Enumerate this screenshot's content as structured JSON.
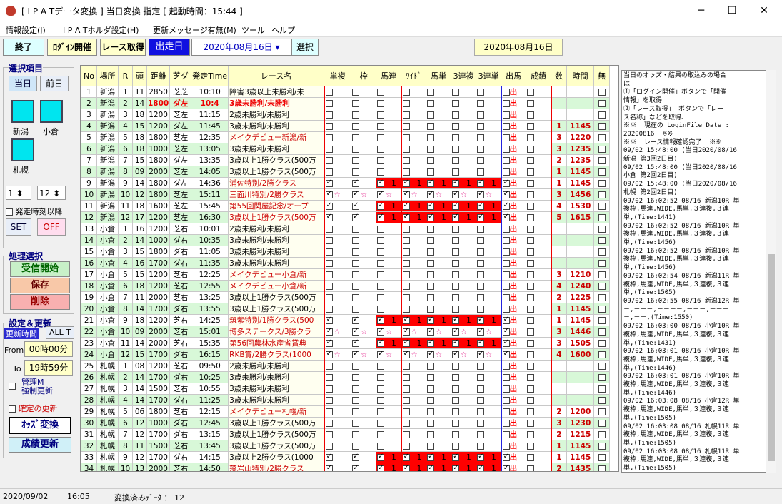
{
  "window": {
    "title": "[ I P A Tデータ変換 ]   当日変換 指定 [ 起動時間：15:44 ]"
  },
  "menu": [
    "情報設定(J)",
    "I P A Tホルダ設定(H)",
    "更新メッセージ有無(M)",
    "ツール",
    "ヘルプ"
  ],
  "toolbar": {
    "end": "終了",
    "login": "ﾛｸﾞｲﾝ開催",
    "race": "レース取得",
    "date_label": "出走日",
    "date_value": "2020年08月16日",
    "select": "選択",
    "date_display": "2020年08月16日"
  },
  "left": {
    "select_title": "選択項目",
    "today": "当日",
    "prev": "前日",
    "venues": [
      "新潟",
      "小倉",
      "札幌"
    ],
    "spin1": "1",
    "spin2": "12",
    "after_start": "発走時刻以降",
    "set": "SET",
    "off": "OFF",
    "proc_title": "処理選択",
    "recv": "受信開始",
    "save": "保存",
    "del": "削除",
    "setting_title": "設定＆更新",
    "update_time": "更新時間",
    "alt": "ALL T",
    "from_label": "From",
    "from_val": "00時00分",
    "to_label": "To",
    "to_val": "19時59分",
    "manage1": "管理M",
    "manage2": "強制更新",
    "confirm": "確定の更新",
    "odds": "ｵｯｽﾞ変換",
    "result": "成績更新"
  },
  "grid": {
    "headers": [
      "No",
      "場所",
      "R",
      "頭",
      "距離",
      "芝ダ",
      "発走Time",
      "レース名",
      "単複",
      "枠",
      "馬連",
      "ﾜｲﾄﾞ",
      "馬単",
      "3連複",
      "3連単",
      "出馬",
      "成績",
      "数",
      "時間",
      "無"
    ],
    "rows": [
      [
        "1",
        "新潟",
        "1",
        "11",
        "2850",
        "芝芝",
        "10:10",
        "障害3歳以上未勝利/未"
      ],
      [
        "2",
        "新潟",
        "2",
        "14",
        "1800",
        "ダ左",
        "10:4",
        "3歳未勝利/未勝利"
      ],
      [
        "3",
        "新潟",
        "3",
        "18",
        "1200",
        "芝左",
        "11:15",
        "2歳未勝利/未勝利"
      ],
      [
        "4",
        "新潟",
        "4",
        "15",
        "1200",
        "ダ左",
        "11:45",
        "3歳未勝利/未勝利"
      ],
      [
        "5",
        "新潟",
        "5",
        "18",
        "1800",
        "芝左",
        "12:35",
        "メイクデビュー新潟/新"
      ],
      [
        "6",
        "新潟",
        "6",
        "18",
        "1000",
        "芝左",
        "13:05",
        "3歳未勝利/未勝利"
      ],
      [
        "7",
        "新潟",
        "7",
        "15",
        "1800",
        "ダ左",
        "13:35",
        "3歳以上1勝クラス(500万"
      ],
      [
        "8",
        "新潟",
        "8",
        "09",
        "2000",
        "芝左",
        "14:05",
        "3歳以上1勝クラス(500万"
      ],
      [
        "9",
        "新潟",
        "9",
        "14",
        "1800",
        "ダ左",
        "14:36",
        "浦佐特別/2勝クラス"
      ],
      [
        "10",
        "新潟",
        "10",
        "12",
        "1800",
        "芝左",
        "15:11",
        "三面川特別/2勝クラス"
      ],
      [
        "11",
        "新潟",
        "11",
        "18",
        "1600",
        "芝左",
        "15:45",
        "第55回関屋記念/オープ"
      ],
      [
        "12",
        "新潟",
        "12",
        "17",
        "1200",
        "芝左",
        "16:30",
        "3歳以上1勝クラス(500万"
      ],
      [
        "13",
        "小倉",
        "1",
        "16",
        "1200",
        "芝右",
        "10:01",
        "2歳未勝利/未勝利"
      ],
      [
        "14",
        "小倉",
        "2",
        "14",
        "1000",
        "ダ右",
        "10:35",
        "3歳未勝利/未勝利"
      ],
      [
        "15",
        "小倉",
        "3",
        "15",
        "1800",
        "ダ右",
        "11:05",
        "3歳未勝利/未勝利"
      ],
      [
        "16",
        "小倉",
        "4",
        "16",
        "1700",
        "ダ右",
        "11:35",
        "3歳未勝利/未勝利"
      ],
      [
        "17",
        "小倉",
        "5",
        "15",
        "1200",
        "芝右",
        "12:25",
        "メイクデビュー小倉/新"
      ],
      [
        "18",
        "小倉",
        "6",
        "18",
        "1200",
        "芝右",
        "12:55",
        "メイクデビュー小倉/新"
      ],
      [
        "19",
        "小倉",
        "7",
        "11",
        "2000",
        "芝右",
        "13:25",
        "3歳以上1勝クラス(500万"
      ],
      [
        "20",
        "小倉",
        "8",
        "14",
        "1700",
        "ダ右",
        "13:55",
        "3歳以上1勝クラス(500万"
      ],
      [
        "21",
        "小倉",
        "9",
        "18",
        "1200",
        "芝右",
        "14:25",
        "筑紫特別/1勝クラス(500"
      ],
      [
        "22",
        "小倉",
        "10",
        "09",
        "2000",
        "芝右",
        "15:01",
        "博多ステークス/3勝クラ"
      ],
      [
        "23",
        "小倉",
        "11",
        "14",
        "2000",
        "芝右",
        "15:35",
        "第56回農林水産省賞典"
      ],
      [
        "24",
        "小倉",
        "12",
        "15",
        "1700",
        "ダ右",
        "16:15",
        "RKB賞/2勝クラス(1000"
      ],
      [
        "25",
        "札幌",
        "1",
        "08",
        "1200",
        "芝右",
        "09:50",
        "2歳未勝利/未勝利"
      ],
      [
        "26",
        "札幌",
        "2",
        "14",
        "1700",
        "ダ右",
        "10:25",
        "3歳未勝利/未勝利"
      ],
      [
        "27",
        "札幌",
        "3",
        "14",
        "1500",
        "芝右",
        "10:55",
        "3歳未勝利/未勝利"
      ],
      [
        "28",
        "札幌",
        "4",
        "14",
        "1700",
        "ダ右",
        "11:25",
        "3歳未勝利/未勝利"
      ],
      [
        "29",
        "札幌",
        "5",
        "06",
        "1800",
        "芝右",
        "12:15",
        "メイクデビュー札幌/新"
      ],
      [
        "30",
        "札幌",
        "6",
        "12",
        "1000",
        "ダ右",
        "12:45",
        "3歳以上1勝クラス(500万"
      ],
      [
        "31",
        "札幌",
        "7",
        "12",
        "1700",
        "ダ右",
        "13:15",
        "3歳以上1勝クラス(500万"
      ],
      [
        "32",
        "札幌",
        "8",
        "11",
        "1500",
        "芝右",
        "13:45",
        "3歳以上1勝クラス(500万"
      ],
      [
        "33",
        "札幌",
        "9",
        "12",
        "1700",
        "ダ右",
        "14:15",
        "3歳以上2勝クラス(1000"
      ],
      [
        "34",
        "札幌",
        "10",
        "13",
        "2000",
        "芝右",
        "14:50",
        "藻岩山特別/2勝クラス"
      ],
      [
        "35",
        "札幌",
        "11",
        "13",
        "2000",
        "芝右",
        "15:25",
        "UHB賞/オープン"
      ],
      [
        "36",
        "札幌",
        "12",
        "10",
        "1800",
        "芝右",
        "16:05",
        "石狩特別/1勝クラス(500"
      ]
    ],
    "counts": {
      "4": [
        "1",
        "1145"
      ],
      "5": [
        "3",
        "1220"
      ],
      "6": [
        "3",
        "1235"
      ],
      "7": [
        "2",
        "1235"
      ],
      "8": [
        "1",
        "1145"
      ],
      "9": [
        "1",
        "1145"
      ],
      "10": [
        "3",
        "1456"
      ],
      "11": [
        "4",
        "1530"
      ],
      "12": [
        "5",
        "1615"
      ],
      "17": [
        "3",
        "1210"
      ],
      "18": [
        "4",
        "1240"
      ],
      "19": [
        "2",
        "1225"
      ],
      "20": [
        "1",
        "1145"
      ],
      "21": [
        "1",
        "1145"
      ],
      "22": [
        "3",
        "1446"
      ],
      "23": [
        "3",
        "1505"
      ],
      "24": [
        "4",
        "1600"
      ],
      "29": [
        "2",
        "1200"
      ],
      "30": [
        "3",
        "1230"
      ],
      "31": [
        "2",
        "1215"
      ],
      "32": [
        "1",
        "1145"
      ],
      "33": [
        "1",
        "1145"
      ],
      "34": [
        "2",
        "1435"
      ],
      "35": [
        "4",
        "1505"
      ],
      "36": [
        "4",
        "1550"
      ]
    },
    "shutsu": "出",
    "one": "1",
    "star": "☆",
    "tf": "TF"
  },
  "log": [
    "当日のオッズ・結果の取込みの場合",
    "は",
    "①「ログイン開催」ボタンで「開催",
    "情報」を取得",
    "②「レース取得」 ボタンで「レー",
    "ス名称」などを取得、",
    "",
    "※※  現在の LoginFile Date :",
    "20200816  ※※",
    "※※  レース情報確認完了  ※※",
    "09/02 15:48:00 (当日2020/08/16",
    "新潟 第3回2日目)",
    "09/02 15:48:00 (当日2020/08/16",
    "小倉 第2回2日目)",
    "09/02 15:48:00 (当日2020/08/16",
    "札幌 第2回2日目)",
    "09/02 16:02:52 08/16 新潟10R 単",
    "複枠,馬連,WIDE,馬単,３連複,３連",
    "単,(Time:1441)",
    "09/02 16:02:52 08/16 新潟10R 単",
    "複枠,馬連,WIDE,馬単,３連複,３連",
    "単,(Time:1456)",
    "09/02 16:02:52 08/16 新潟10R 単",
    "複枠,馬連,WIDE,馬単,３連複,３連",
    "単,(Time:1456)",
    "09/02 16:02:54 08/16 新潟11R 単",
    "複枠,馬連,WIDE,馬単,３連複,３連",
    "単,(Time:1505)",
    "09/02 16:02:55 08/16 新潟12R 単",
    "－,－－－,－－－－,－－－,－－－",
    "－,－－,(Time:1550)",
    "09/02 16:03:00 08/16 小倉10R 単",
    "複枠,馬連,WIDE,馬単,３連複,３連",
    "単,(Time:1431)",
    "09/02 16:03:01 08/16 小倉10R 単",
    "複枠,馬連,WIDE,馬単,３連複,３連",
    "単,(Time:1446)",
    "09/02 16:03:01 08/16 小倉10R 単",
    "複枠,馬連,WIDE,馬単,３連複,３連",
    "単,(Time:1446)",
    "09/02 16:03:08 08/16 小倉12R 単",
    "複枠,馬連,WIDE,馬単,３連複,３連",
    "単,(Time:1505)",
    "09/02 16:03:08 08/16 札幌11R 単",
    "複枠,馬連,WIDE,馬単,３連複,３連",
    "単,(Time:1505)",
    "09/02 16:03:08 08/16 札幌11R 単",
    "複枠,馬連,WIDE,馬単,３連複,３連",
    "単,(Time:1505)"
  ],
  "status": {
    "date": "2020/09/02",
    "time": "16:05",
    "converted": "変換済みﾃﾞｰﾀ  ： 12"
  }
}
